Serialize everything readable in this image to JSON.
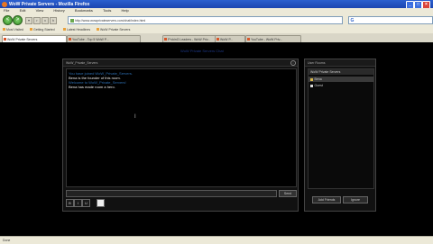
{
  "window": {
    "title": "WoW Private Servers - Mozilla Firefox"
  },
  "menu": [
    "File",
    "Edit",
    "View",
    "History",
    "Bookmarks",
    "Tools",
    "Help"
  ],
  "nav": {
    "back": "<",
    "forward": ">",
    "stop": "x",
    "reload": "r",
    "home": "h",
    "url": "http://www.wowprivateservers.com/chat/index.html",
    "search_placeholder": ""
  },
  "bookmarks": [
    "Most Visited",
    "Getting Started",
    "Latest Headlines",
    "WoW Private Servers"
  ],
  "tabs": [
    {
      "label": "WoW Private Servers",
      "active": true
    },
    {
      "label": "YouTube - Top 5 WoW P...",
      "active": false
    },
    {
      "label": "F*ckinG Leaders - WoW Priv...",
      "active": false
    },
    {
      "label": "WoW P...",
      "active": false
    },
    {
      "label": "YouTube - WoW Priv...",
      "active": false
    }
  ],
  "page": {
    "top_link": "WoW Private Servers Chat",
    "chat": {
      "header": "WoW_Private_Servers",
      "lines": [
        {
          "text": "You have joined WoW_Private_Servers.",
          "type": "sys"
        },
        {
          "text": "Bena is the founder of this room.",
          "type": "msg"
        },
        {
          "text": "Welcome to WoW_Private_Servers!",
          "type": "sys"
        },
        {
          "text": "Bena has made room a hero.",
          "type": "msg"
        }
      ],
      "send_label": "Send",
      "tools": [
        "B",
        "I",
        "U"
      ]
    },
    "users": {
      "header": "User Rooms",
      "room": "WoW Private Servers",
      "list": [
        {
          "name": "Bena",
          "selected": true
        },
        {
          "name": "Guest",
          "selected": false
        }
      ],
      "btn_add": "Add Friends",
      "btn_ignore": "Ignore"
    }
  },
  "status": {
    "text": "Done"
  }
}
